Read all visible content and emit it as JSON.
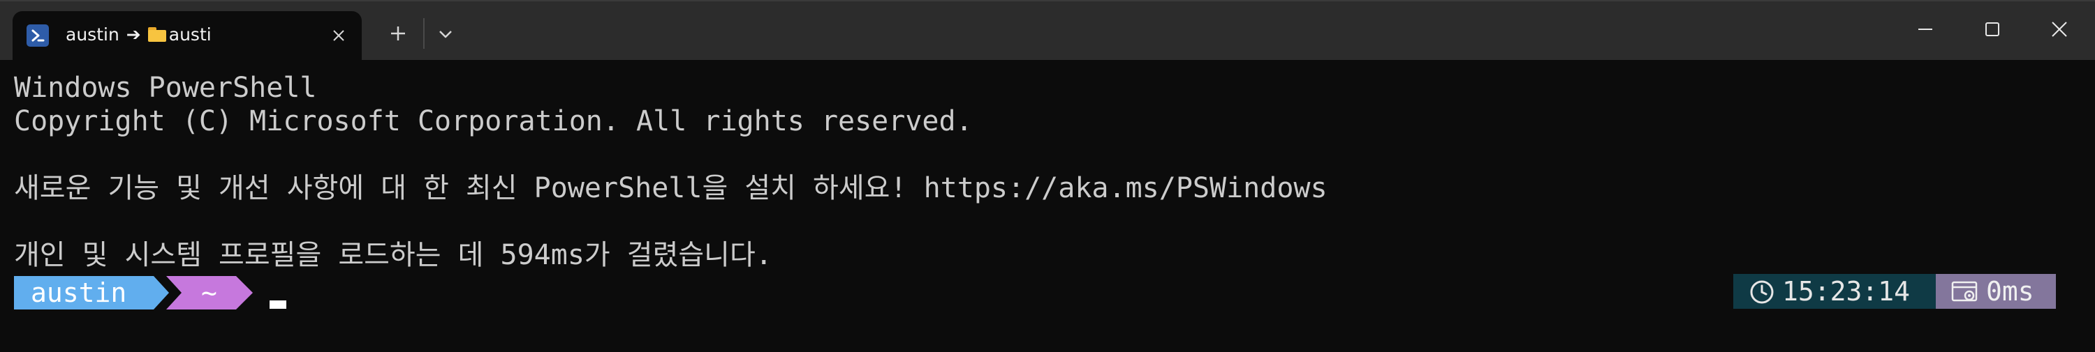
{
  "window": {
    "tab": {
      "icon": "powershell-icon",
      "user": "austin",
      "arrow": "➔",
      "folder_icon": "folder-icon",
      "folder": "austi"
    },
    "controls": [
      "new-tab",
      "tab-dropdown",
      "minimize",
      "maximize",
      "close"
    ]
  },
  "terminal": {
    "lines": [
      "Windows PowerShell",
      "Copyright (C) Microsoft Corporation. All rights reserved.",
      "새로운 기능 및 개선 사항에 대 한 최신 PowerShell을 설치 하세요! https://aka.ms/PSWindows",
      "개인 및 시스템 프로필을 로드하는 데 594ms가 걸렸습니다."
    ],
    "prompt": {
      "user": "austin",
      "path": "~",
      "time": "15:23:14",
      "exec_time": "0ms"
    }
  },
  "colors": {
    "background": "#0c0c0c",
    "titlebar": "#2c2c2c",
    "user_segment": "#61aeee",
    "path_segment": "#c678dd",
    "time_segment": "#0f3a45",
    "exec_segment": "#83769c"
  }
}
